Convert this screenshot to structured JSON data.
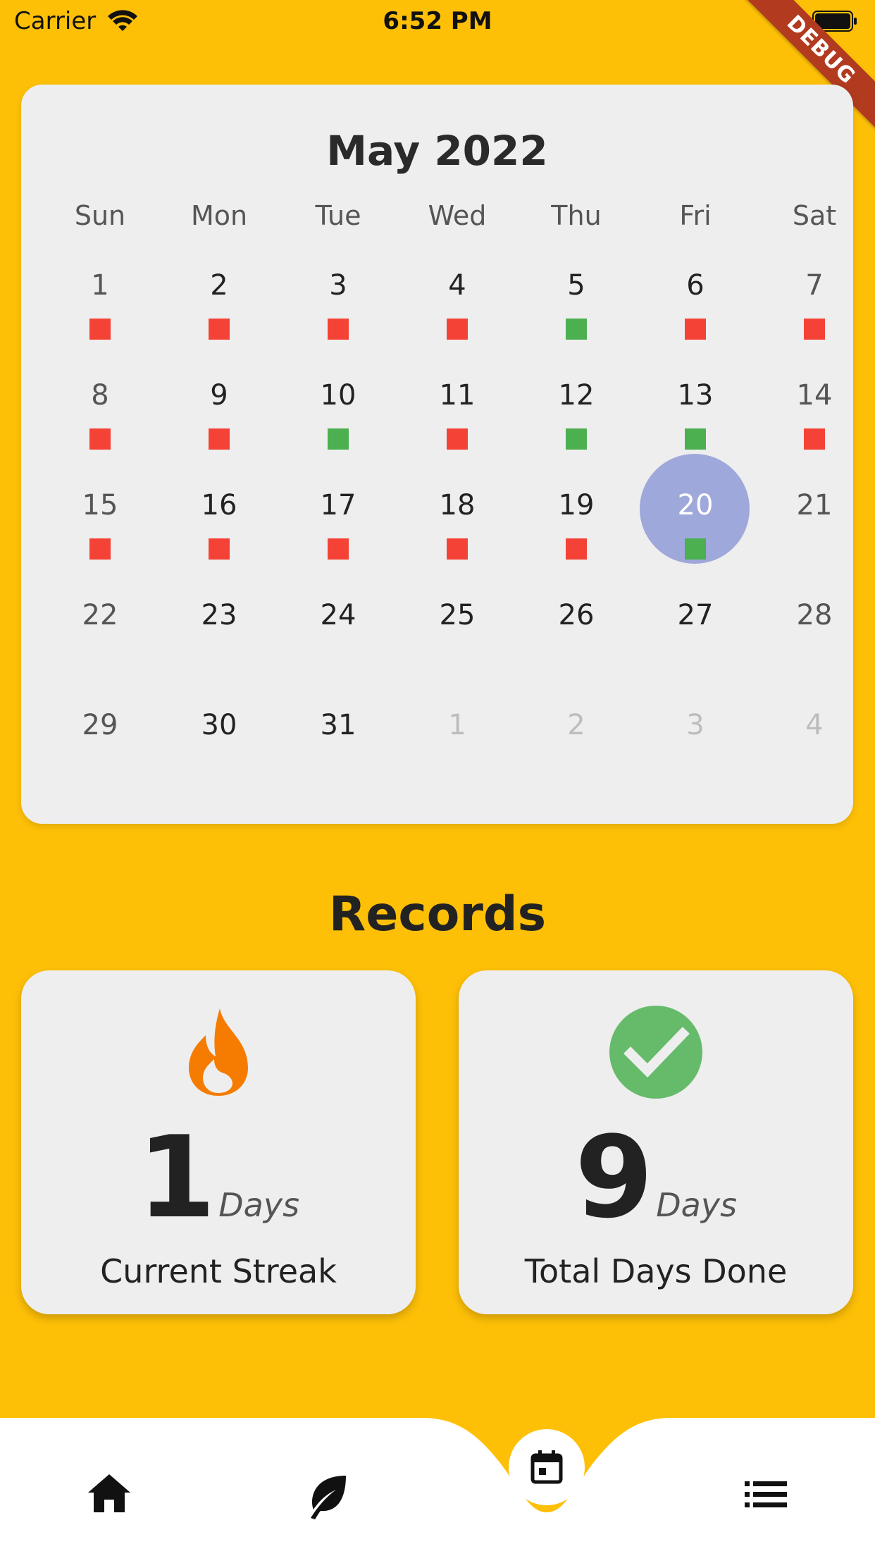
{
  "status_bar": {
    "carrier": "Carrier",
    "time": "6:52 PM",
    "icons": [
      "wifi-icon",
      "battery-icon"
    ]
  },
  "debug_banner": "DEBUG",
  "calendar": {
    "month_title": "May 2022",
    "weekdays": [
      "Sun",
      "Mon",
      "Tue",
      "Wed",
      "Thu",
      "Fri",
      "Sat"
    ],
    "selected_day": "20",
    "weeks": [
      [
        {
          "day": "1",
          "status": "red"
        },
        {
          "day": "2",
          "status": "red"
        },
        {
          "day": "3",
          "status": "red"
        },
        {
          "day": "4",
          "status": "red"
        },
        {
          "day": "5",
          "status": "green"
        },
        {
          "day": "6",
          "status": "red"
        },
        {
          "day": "7",
          "status": "red"
        }
      ],
      [
        {
          "day": "8",
          "status": "red"
        },
        {
          "day": "9",
          "status": "red"
        },
        {
          "day": "10",
          "status": "green"
        },
        {
          "day": "11",
          "status": "red"
        },
        {
          "day": "12",
          "status": "green"
        },
        {
          "day": "13",
          "status": "green"
        },
        {
          "day": "14",
          "status": "red"
        }
      ],
      [
        {
          "day": "15",
          "status": "red"
        },
        {
          "day": "16",
          "status": "red"
        },
        {
          "day": "17",
          "status": "red"
        },
        {
          "day": "18",
          "status": "red"
        },
        {
          "day": "19",
          "status": "red"
        },
        {
          "day": "20",
          "status": "green",
          "selected": true
        },
        {
          "day": "21",
          "status": null
        }
      ],
      [
        {
          "day": "22",
          "status": null
        },
        {
          "day": "23",
          "status": null
        },
        {
          "day": "24",
          "status": null
        },
        {
          "day": "25",
          "status": null
        },
        {
          "day": "26",
          "status": null
        },
        {
          "day": "27",
          "status": null
        },
        {
          "day": "28",
          "status": null
        }
      ],
      [
        {
          "day": "29",
          "status": null
        },
        {
          "day": "30",
          "status": null
        },
        {
          "day": "31",
          "status": null
        },
        {
          "day": "1",
          "status": null,
          "outside": true
        },
        {
          "day": "2",
          "status": null,
          "outside": true
        },
        {
          "day": "3",
          "status": null,
          "outside": true
        },
        {
          "day": "4",
          "status": null,
          "outside": true
        }
      ]
    ]
  },
  "records": {
    "title": "Records",
    "current_streak": {
      "icon": "fire-icon",
      "value": "1",
      "unit": "Days",
      "label": "Current Streak"
    },
    "total_days": {
      "icon": "check-circle-icon",
      "value": "9",
      "unit": "Days",
      "label": "Total Days Done"
    }
  },
  "bottom_nav": {
    "items": [
      {
        "icon": "home-icon"
      },
      {
        "icon": "leaf-icon"
      },
      {
        "icon": "calendar-icon",
        "active": true
      },
      {
        "icon": "list-icon"
      }
    ]
  },
  "colors": {
    "background": "#FEC007",
    "card": "#EEEEEE",
    "success": "#4CAF50",
    "failure": "#F44336",
    "selected": "#9FA8DA",
    "fire": "#F57C00"
  }
}
